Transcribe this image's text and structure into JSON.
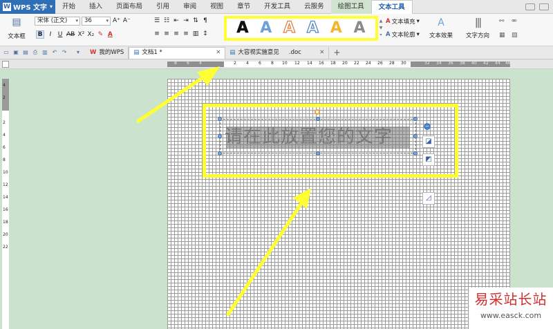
{
  "menubar": {
    "app_name": "WPS 文字",
    "logo": "W",
    "items": [
      "开始",
      "插入",
      "页面布局",
      "引用",
      "审阅",
      "视图",
      "章节",
      "开发工具",
      "云服务",
      "绘图工具",
      "文本工具"
    ]
  },
  "ribbon": {
    "textbox_label": "文本框",
    "font_name": "宋体 (正文)",
    "font_size": "36",
    "font_grow": "A⁺",
    "font_shrink": "A⁻",
    "bold": "B",
    "italic": "I",
    "underline": "U",
    "strike": "AB",
    "superscript": "X²",
    "subscript": "X₂",
    "text_fill_label": "文本填充",
    "text_outline_label": "文本轮廓",
    "text_effect_label": "文本效果",
    "text_direction_label": "文字方向",
    "style_glyph": "A",
    "style_colors": [
      "#111111",
      "#6d9fd8",
      "#e07a3a",
      "#4f82c0",
      "#f4b52c",
      "#8a8a8a"
    ]
  },
  "tabs": {
    "home_tab": "我的WPS",
    "active_doc": "文档1 *",
    "other_doc": "大容视实施意见",
    "other_doc_ext": ".doc",
    "add": "+"
  },
  "ruler": {
    "h_labels_dark": [
      "8",
      "6",
      "4"
    ],
    "h_labels": [
      "2",
      "4",
      "6",
      "8",
      "10",
      "12",
      "14",
      "16",
      "18",
      "20",
      "22",
      "24",
      "26",
      "28",
      "30"
    ],
    "h_labels_right": [
      "32",
      "34",
      "36",
      "38",
      "40",
      "42",
      "44",
      "46"
    ],
    "v_labels": [
      "4",
      "2",
      "2",
      "4",
      "6",
      "8",
      "10",
      "12",
      "14",
      "16",
      "18",
      "20",
      "22"
    ]
  },
  "document": {
    "placeholder_text": "请在此放置您的文字"
  },
  "watermark": {
    "site_name": "易采站长站",
    "url": "www.easck.com"
  },
  "colors": {
    "highlight": "#ffff33",
    "accent_blue": "#2f6fb6",
    "workspace_green": "#cbe2cd"
  }
}
